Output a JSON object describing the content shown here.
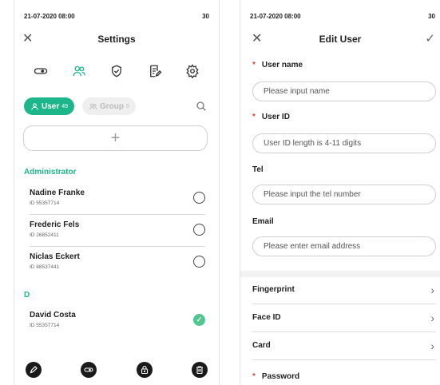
{
  "settings_screen": {
    "status": {
      "time": "21-07-2020 08:00",
      "battery": "30"
    },
    "title": "Settings",
    "toolbar_icons": [
      "key-icon",
      "users-icon",
      "shield-check-icon",
      "log-edit-icon",
      "gear-icon"
    ],
    "tabs": {
      "user": {
        "label": "User",
        "count": "49"
      },
      "group": {
        "label": "Group",
        "count": "5"
      }
    },
    "add_symbol": "+",
    "sections": [
      {
        "header": "Administrator",
        "users": [
          {
            "name": "Nadine Franke",
            "id": "ID 55357714",
            "selected": false
          },
          {
            "name": "Frederic Fels",
            "id": "ID 26852411",
            "selected": false
          },
          {
            "name": "Niclas Eckert",
            "id": "ID 88537441",
            "selected": false
          }
        ]
      },
      {
        "header": "D",
        "users": [
          {
            "name": "David Costa",
            "id": "ID 55357714",
            "selected": true
          }
        ]
      }
    ],
    "bottom_actions": [
      "edit-icon",
      "key-icon",
      "lock-icon",
      "trash-icon"
    ]
  },
  "edit_user_screen": {
    "status": {
      "time": "21-07-2020 08:00",
      "battery": "30"
    },
    "title": "Edit User",
    "fields": {
      "user_name": {
        "label": "User name",
        "required": true,
        "placeholder": "Please input name"
      },
      "user_id": {
        "label": "User ID",
        "required": true,
        "placeholder": "User ID length is 4-11 digits"
      },
      "tel": {
        "label": "Tel",
        "required": false,
        "placeholder": "Please input the tel number"
      },
      "email": {
        "label": "Email",
        "required": false,
        "placeholder": "Please enter email address"
      }
    },
    "menu": {
      "fingerprint": "Fingerprint",
      "face_id": "Face ID",
      "card": "Card"
    },
    "password": {
      "label": "Password",
      "required": true
    },
    "required_mark": "*",
    "chevron": "›"
  },
  "colors": {
    "accent": "#1db58a",
    "required": "#e0464a",
    "selected_check": "#4fc88f"
  }
}
